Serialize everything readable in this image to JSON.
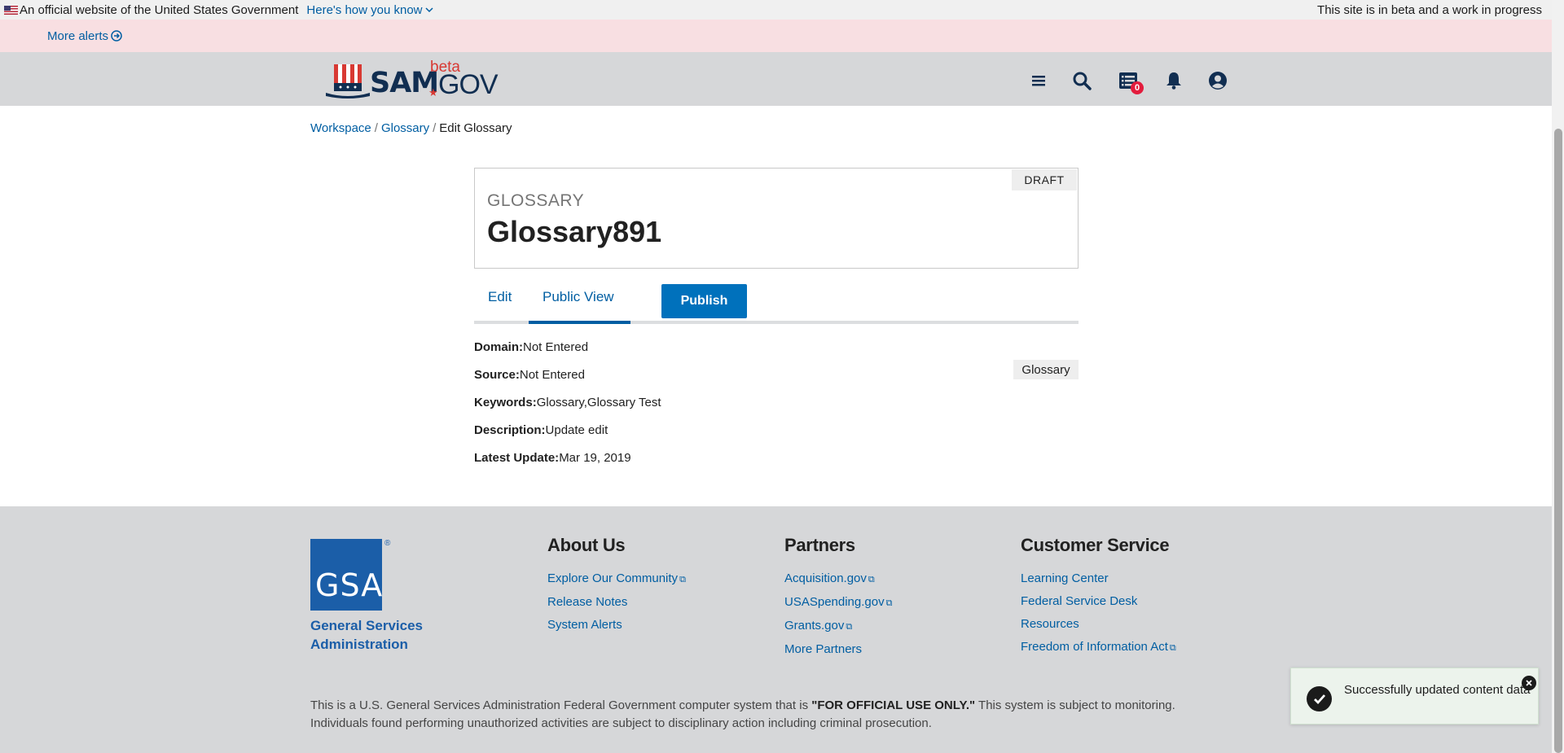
{
  "gov_banner": {
    "official_text": "An official website of the United States Government",
    "how_link": "Here's how you know",
    "beta_text": "This site is in beta and a work in progress"
  },
  "alerts": {
    "more_alerts": "More alerts"
  },
  "header": {
    "logo_sam": "SAM",
    "logo_beta": "beta",
    "logo_gov": "GOV",
    "notification_count": "0"
  },
  "breadcrumb": {
    "items": [
      "Workspace",
      "Glossary"
    ],
    "separator": "/",
    "current": "Edit Glossary"
  },
  "card": {
    "status": "DRAFT",
    "label": "GLOSSARY",
    "title": "Glossary891"
  },
  "tabs": {
    "edit": "Edit",
    "public_view": "Public View",
    "publish": "Publish"
  },
  "details": [
    {
      "label": "Domain:",
      "value": "Not Entered"
    },
    {
      "label": "Source:",
      "value": "Not Entered"
    },
    {
      "label": "Keywords:",
      "value": "Glossary,Glossary Test"
    },
    {
      "label": "Description:",
      "value": "Update edit"
    },
    {
      "label": "Latest Update:",
      "value": "Mar 19, 2019"
    }
  ],
  "type_tag": "Glossary",
  "footer": {
    "gsa_text": "GSA",
    "gsa_reg": "®",
    "gsa_name": "General Services Administration",
    "about": {
      "heading": "About Us",
      "links": [
        "Explore Our Community",
        "Release Notes",
        "System Alerts"
      ]
    },
    "partners": {
      "heading": "Partners",
      "links": [
        "Acquisition.gov",
        "USASpending.gov",
        "Grants.gov",
        "More Partners"
      ]
    },
    "customer_service": {
      "heading": "Customer Service",
      "links": [
        "Learning Center",
        "Federal Service Desk",
        "Resources",
        "Freedom of Information Act"
      ]
    },
    "disclaimer_pre": "This is a U.S. General Services Administration Federal Government computer system that is ",
    "disclaimer_bold": "\"FOR OFFICIAL USE ONLY.\"",
    "disclaimer_post": " This system is subject to monitoring. Individuals found performing unauthorized activities are subject to disciplinary action including criminal prosecution."
  },
  "toast": {
    "message": "Successfully updated content data"
  },
  "colors": {
    "primary": "#005ea2",
    "brand_navy": "#112e51",
    "brand_red": "#d83933",
    "gsa_blue": "#1b5ea8",
    "toast_bg": "#ecf3ec"
  }
}
